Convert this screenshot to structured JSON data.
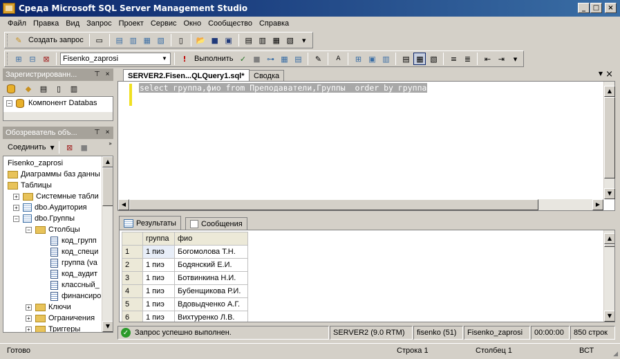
{
  "window": {
    "title": "Среда Microsoft SQL Server Management Studio",
    "min": "_",
    "max": "□",
    "close": "×"
  },
  "menu": [
    "Файл",
    "Правка",
    "Вид",
    "Запрос",
    "Проект",
    "Сервис",
    "Окно",
    "Сообщество",
    "Справка"
  ],
  "toolbar1": {
    "new_query": "Создать запрос"
  },
  "toolbar2": {
    "database": "Fisenko_zaprosi",
    "execute": "Выполнить"
  },
  "registered_servers": {
    "title": "Зарегистрированн...",
    "item": "Компонент Databas"
  },
  "object_explorer": {
    "title": "Обозреватель объ...",
    "connect": "Соединить",
    "items": [
      {
        "label": "Fisenko_zaprosi"
      },
      {
        "label": "Диаграммы баз данны"
      },
      {
        "label": "Таблицы"
      },
      {
        "label": "Системные табли"
      },
      {
        "label": "dbo.Аудитория"
      },
      {
        "label": "dbo.Группы"
      },
      {
        "label": "Столбцы"
      },
      {
        "label": "код_групп"
      },
      {
        "label": "код_специ"
      },
      {
        "label": "группа (va"
      },
      {
        "label": "код_аудит"
      },
      {
        "label": "классный_"
      },
      {
        "label": "финансиро"
      },
      {
        "label": "Ключи"
      },
      {
        "label": "Ограничения"
      },
      {
        "label": "Триггеры"
      }
    ]
  },
  "tabs": {
    "query": "SERVER2.Fisen...QLQuery1.sql*",
    "summary": "Сводка"
  },
  "query_text": "select группа,фио from Преподаватели,Группы  order by группа",
  "result_tabs": {
    "results": "Результаты",
    "messages": "Сообщения"
  },
  "grid": {
    "columns": [
      "группа",
      "фио"
    ],
    "rows": [
      {
        "n": "1",
        "g": "1 пиэ",
        "f": "Богомолова Т.Н."
      },
      {
        "n": "2",
        "g": "1 пиэ",
        "f": "Бодянский Е.И."
      },
      {
        "n": "3",
        "g": "1 пиэ",
        "f": "Ботвинкина Н.И."
      },
      {
        "n": "4",
        "g": "1 пиэ",
        "f": "Бубенщикова Р.И."
      },
      {
        "n": "5",
        "g": "1 пиэ",
        "f": "Вдовыдченко А.Г."
      },
      {
        "n": "6",
        "g": "1 пиэ",
        "f": "Вихтуренко Л.В."
      }
    ]
  },
  "query_status": {
    "message": "Запрос успешно выполнен.",
    "server": "SERVER2 (9.0 RTM)",
    "user": "fisenko (51)",
    "db": "Fisenko_zaprosi",
    "time": "00:00:00",
    "rows": "850 строк"
  },
  "statusbar": {
    "ready": "Готово",
    "line": "Строка 1",
    "col": "Столбец 1",
    "mode": "ВСТ"
  }
}
